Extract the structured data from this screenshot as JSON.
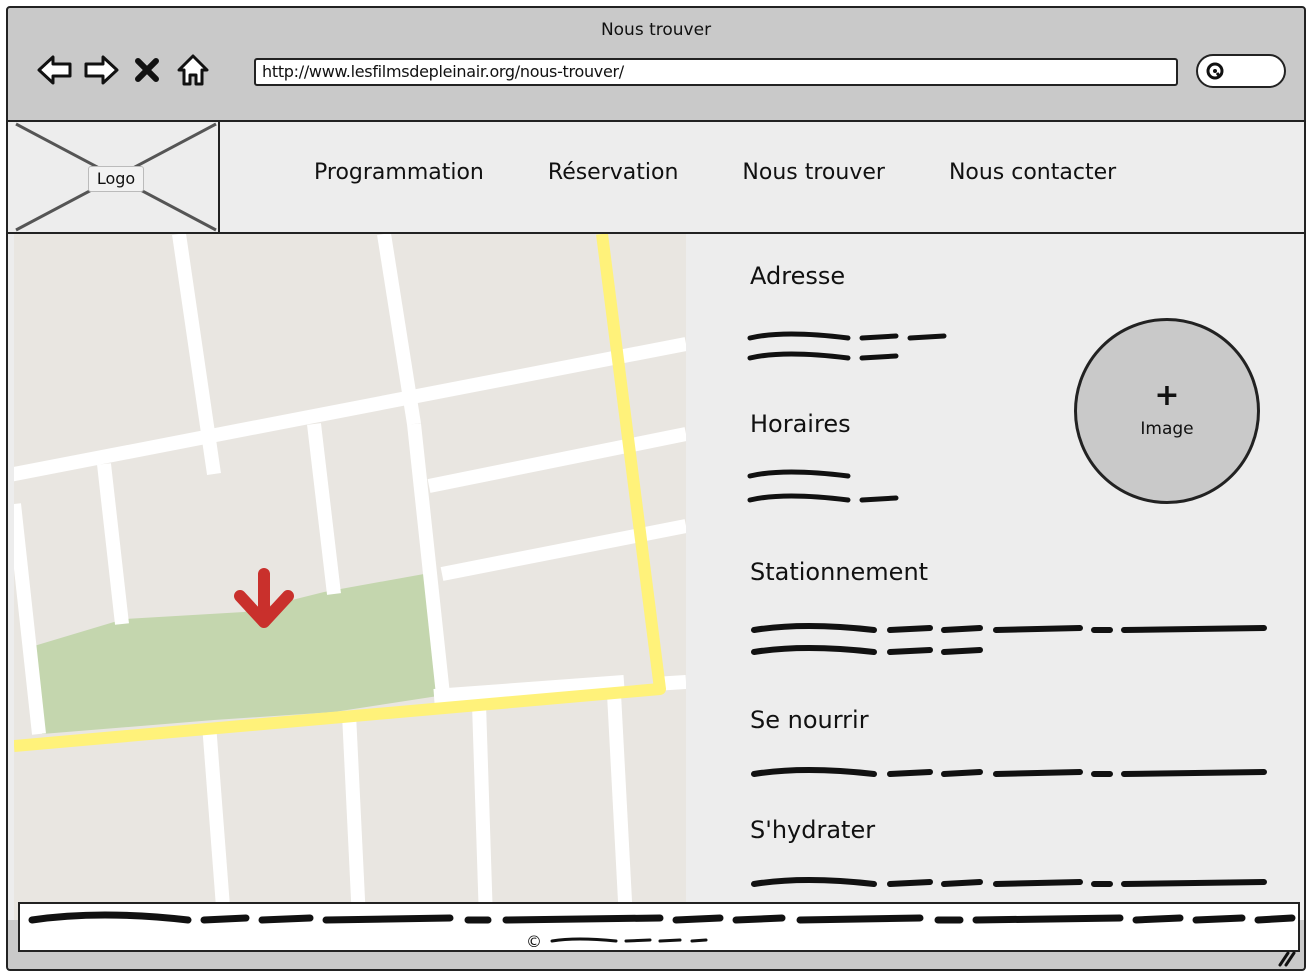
{
  "window": {
    "title": "Nous trouver",
    "url": "http://www.lesfilmsdepleinair.org/nous-trouver/"
  },
  "logo": {
    "label": "Logo"
  },
  "menu": {
    "items": [
      {
        "label": "Programmation"
      },
      {
        "label": "Réservation"
      },
      {
        "label": "Nous trouver"
      },
      {
        "label": "Nous contacter"
      }
    ]
  },
  "sections": {
    "adresse": "Adresse",
    "horaires": "Horaires",
    "stationnement": "Stationnement",
    "se_nourrir": "Se nourrir",
    "s_hydrater": "S'hydrater"
  },
  "image_placeholder": {
    "plus": "+",
    "label": "Image"
  },
  "footer": {
    "copyright_symbol": "©"
  },
  "colors": {
    "map_background": "#e9e6e1",
    "map_road": "#ffffff",
    "map_highway": "#fff27a",
    "map_park": "#c4d6ae",
    "marker": "#c9302c",
    "chrome": "#c9c9c9",
    "page": "#ededed"
  }
}
